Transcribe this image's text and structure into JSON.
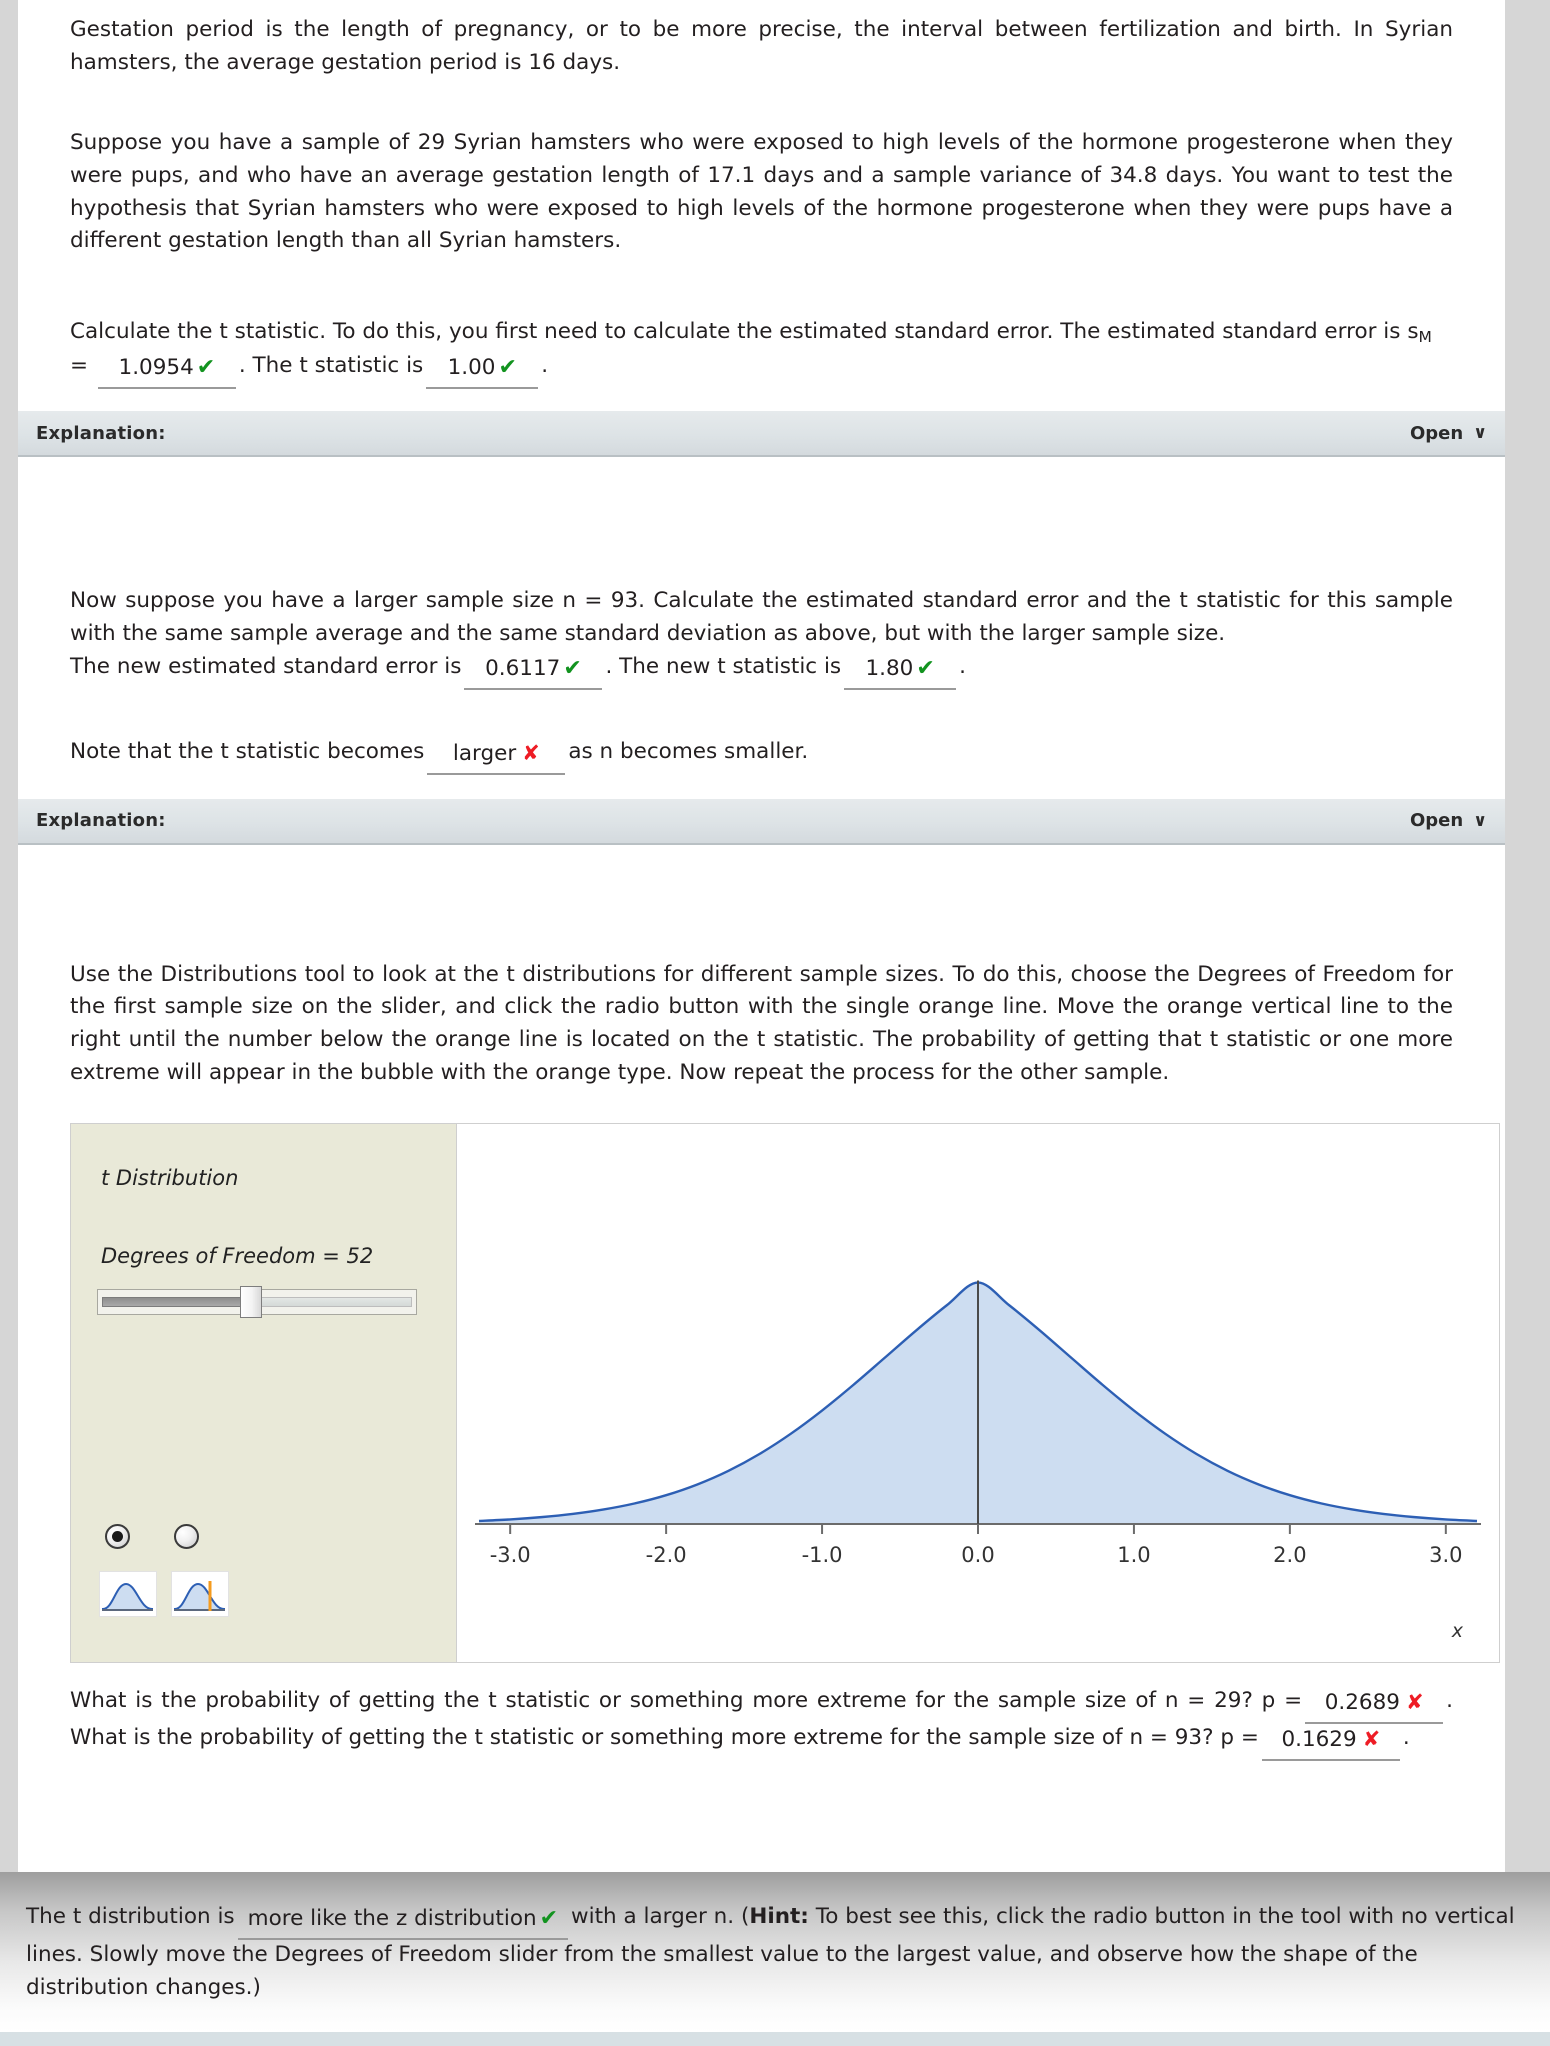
{
  "intro": {
    "p1": "Gestation period is the length of pregnancy, or to be more precise, the interval between fertilization and birth. In Syrian hamsters, the average gestation period is 16 days.",
    "p2": "Suppose you have a sample of 29 Syrian hamsters who were exposed to high levels of the hormone progesterone when they were pups, and who have an average gestation length of 17.1 days and a sample variance of 34.8 days. You want to test the hypothesis that Syrian hamsters who were exposed to high levels of the hormone progesterone when they were pups have a different gestation length than all Syrian hamsters."
  },
  "q1": {
    "lead": "Calculate the t statistic. To do this, you first need to calculate the estimated standard error. The estimated standard error is s",
    "sub": "M",
    "eq": " = ",
    "se_value": "1.0954",
    "se_mark": "✔",
    "mid": ". The t statistic is",
    "t_value": "1.00",
    "t_mark": "✔",
    "end": "."
  },
  "explanation1": {
    "label": "Explanation:",
    "open": "Open",
    "chevron": "∨"
  },
  "q2": {
    "p": "Now suppose you have a larger sample size n = 93. Calculate the estimated standard error and the t statistic for this sample with the same sample average and the same standard deviation as above, but with the larger sample size.",
    "lead": "The new estimated standard error is",
    "se_value": "0.6117",
    "se_mark": "✔",
    "mid": ". The new t statistic is",
    "t_value": "1.80",
    "t_mark": "✔",
    "end": ".",
    "note_lead": "Note that the t statistic becomes",
    "note_value": "larger",
    "note_mark": "✘",
    "note_end": "as n becomes smaller."
  },
  "explanation2": {
    "label": "Explanation:",
    "open": "Open",
    "chevron": "∨"
  },
  "tool_intro": "Use the Distributions tool to look at the t distributions for different sample sizes. To do this, choose the Degrees of Freedom for the first sample size on the slider, and click the radio button with the single orange line. Move the orange vertical line to the right until the number below the orange line is located on the t statistic. The probability of getting that t statistic or one more extreme will appear in the bubble with the orange type. Now repeat the process for the other sample.",
  "tool": {
    "title": "t Distribution",
    "dof_label": "Degrees of Freedom = 52",
    "dof_value": 52,
    "radio_selected_index": 0,
    "radio_options": [
      "no-vertical-line",
      "single-orange-line"
    ]
  },
  "chart_data": {
    "type": "line",
    "title": "t Distribution",
    "xlabel": "x",
    "ylabel": "",
    "xlim": [
      -3.2,
      3.2
    ],
    "ylim": [
      0,
      0.42
    ],
    "xticks": [
      -3.0,
      -2.0,
      -1.0,
      0.0,
      1.0,
      2.0,
      3.0
    ],
    "xticklabels": [
      "-3.0",
      "-2.0",
      "-1.0",
      "0.0",
      "1.0",
      "2.0",
      "3.0"
    ],
    "grid": false,
    "legend": null,
    "curve_color": "#2d5fb4",
    "fill_color": "#cdddf1",
    "vertical_line": {
      "x": 0.0,
      "color": "#4a4a4a"
    },
    "degrees_of_freedom": 52,
    "x": [
      -3.2,
      -3.0,
      -2.8,
      -2.6,
      -2.4,
      -2.2,
      -2.0,
      -1.8,
      -1.6,
      -1.4,
      -1.2,
      -1.0,
      -0.8,
      -0.6,
      -0.4,
      -0.2,
      0.0,
      0.2,
      0.4,
      0.6,
      0.8,
      1.0,
      1.2,
      1.4,
      1.6,
      1.8,
      2.0,
      2.2,
      2.4,
      2.6,
      2.8,
      3.0,
      3.2
    ],
    "y": [
      0.0035,
      0.0052,
      0.0078,
      0.0114,
      0.0165,
      0.0234,
      0.0327,
      0.0449,
      0.0604,
      0.0796,
      0.1025,
      0.1288,
      0.1578,
      0.1884,
      0.2192,
      0.2483,
      0.2741,
      0.2483,
      0.2192,
      0.1884,
      0.1578,
      0.1288,
      0.1025,
      0.0796,
      0.0604,
      0.0449,
      0.0327,
      0.0234,
      0.0165,
      0.0114,
      0.0078,
      0.0052,
      0.0035
    ]
  },
  "q3": {
    "lead": "What is the probability of getting the t statistic or something more extreme for the sample size of n = 29? p =",
    "p1_value": "0.2689",
    "p1_mark": "✘",
    "mid": ". What is the probability of getting the t statistic or something more extreme for the sample size of n = 93? p =",
    "p2_value": "0.1629",
    "p2_mark": "✘",
    "end": "."
  },
  "bottom": {
    "lead": "The t distribution is",
    "value": "more like the z distribution",
    "mark": "✔",
    "mid": "with a larger n. (",
    "hint_label": "Hint:",
    "rest": " To best see this, click the radio button in the tool with no vertical lines. Slowly move the Degrees of Freedom slider from the smallest value to the largest value, and observe how the shape of the distribution changes.)"
  },
  "colors": {
    "page_bg": "#d6d6d6",
    "card_bg": "#ffffff",
    "correct": "#12931f",
    "incorrect": "#ee1c25",
    "panel_bg": "#e9e9d8",
    "curve": "#2d5fb4",
    "fill": "#cdddf1",
    "explanation_bar": "#dde3e6"
  }
}
